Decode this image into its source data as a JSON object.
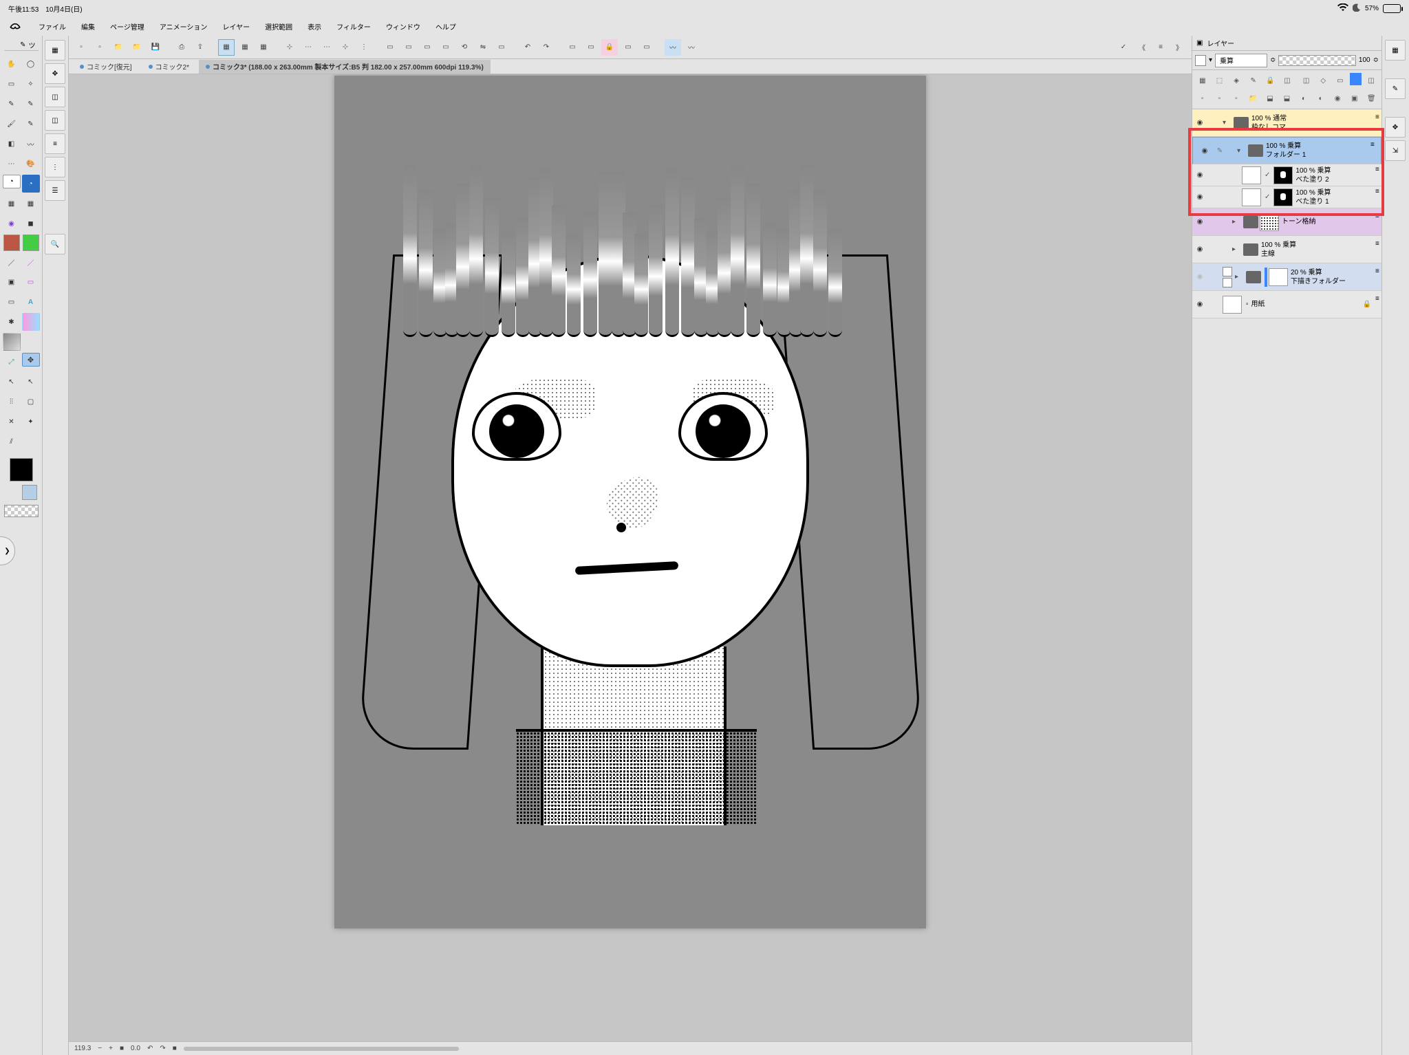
{
  "status": {
    "time": "午後11:53",
    "date": "10月4日(日)",
    "battery": "57%"
  },
  "menu": {
    "file": "ファイル",
    "edit": "編集",
    "page": "ページ管理",
    "anim": "アニメーション",
    "layer": "レイヤー",
    "sel": "選択範囲",
    "view": "表示",
    "filter": "フィルター",
    "window": "ウィンドウ",
    "help": "ヘルプ"
  },
  "tabs": [
    {
      "label": "コミック[復元]",
      "active": false
    },
    {
      "label": "コミック2*",
      "active": false
    },
    {
      "label": "コミック3* (188.00 x 263.00mm 製本サイズ:B5 判 182.00 x 257.00mm 600dpi 119.3%)",
      "active": true
    }
  ],
  "zoom": "119.3",
  "rotate": "0.0",
  "tool_label": "ツ",
  "layer_panel": {
    "title": "レイヤー",
    "blend": "乗算",
    "opacity": "100",
    "layers": [
      {
        "kind": "folder",
        "line1": "100 % 通常",
        "line2": "枠なしコマ",
        "indent": 0,
        "sel": false,
        "open": true,
        "bg": "#fff0bf"
      },
      {
        "kind": "folder",
        "line1": "100 % 乗算",
        "line2": "フォルダー 1",
        "indent": 1,
        "sel": true,
        "open": true,
        "edit": true
      },
      {
        "kind": "layer",
        "line1": "100 % 乗算",
        "line2": "べた塗り 2",
        "indent": 2,
        "sel": false,
        "masked": true
      },
      {
        "kind": "layer",
        "line1": "100 % 乗算",
        "line2": "べた塗り 1",
        "indent": 2,
        "sel": false,
        "masked": true
      },
      {
        "kind": "folder",
        "line1": "",
        "line2": "トーン格納",
        "indent": 1,
        "sel": false,
        "open": false,
        "tone": true,
        "bg": "#e1c8ea"
      },
      {
        "kind": "folder",
        "line1": "100 % 乗算",
        "line2": "主線",
        "indent": 1,
        "sel": false,
        "open": false
      },
      {
        "kind": "folder",
        "line1": "20 % 乗算",
        "line2": "下描きフォルダー",
        "indent": 0,
        "sel": false,
        "open": false,
        "blue": true,
        "light": true
      },
      {
        "kind": "paper",
        "line1": "",
        "line2": "用紙",
        "indent": 0,
        "sel": false,
        "locked": true
      }
    ]
  }
}
